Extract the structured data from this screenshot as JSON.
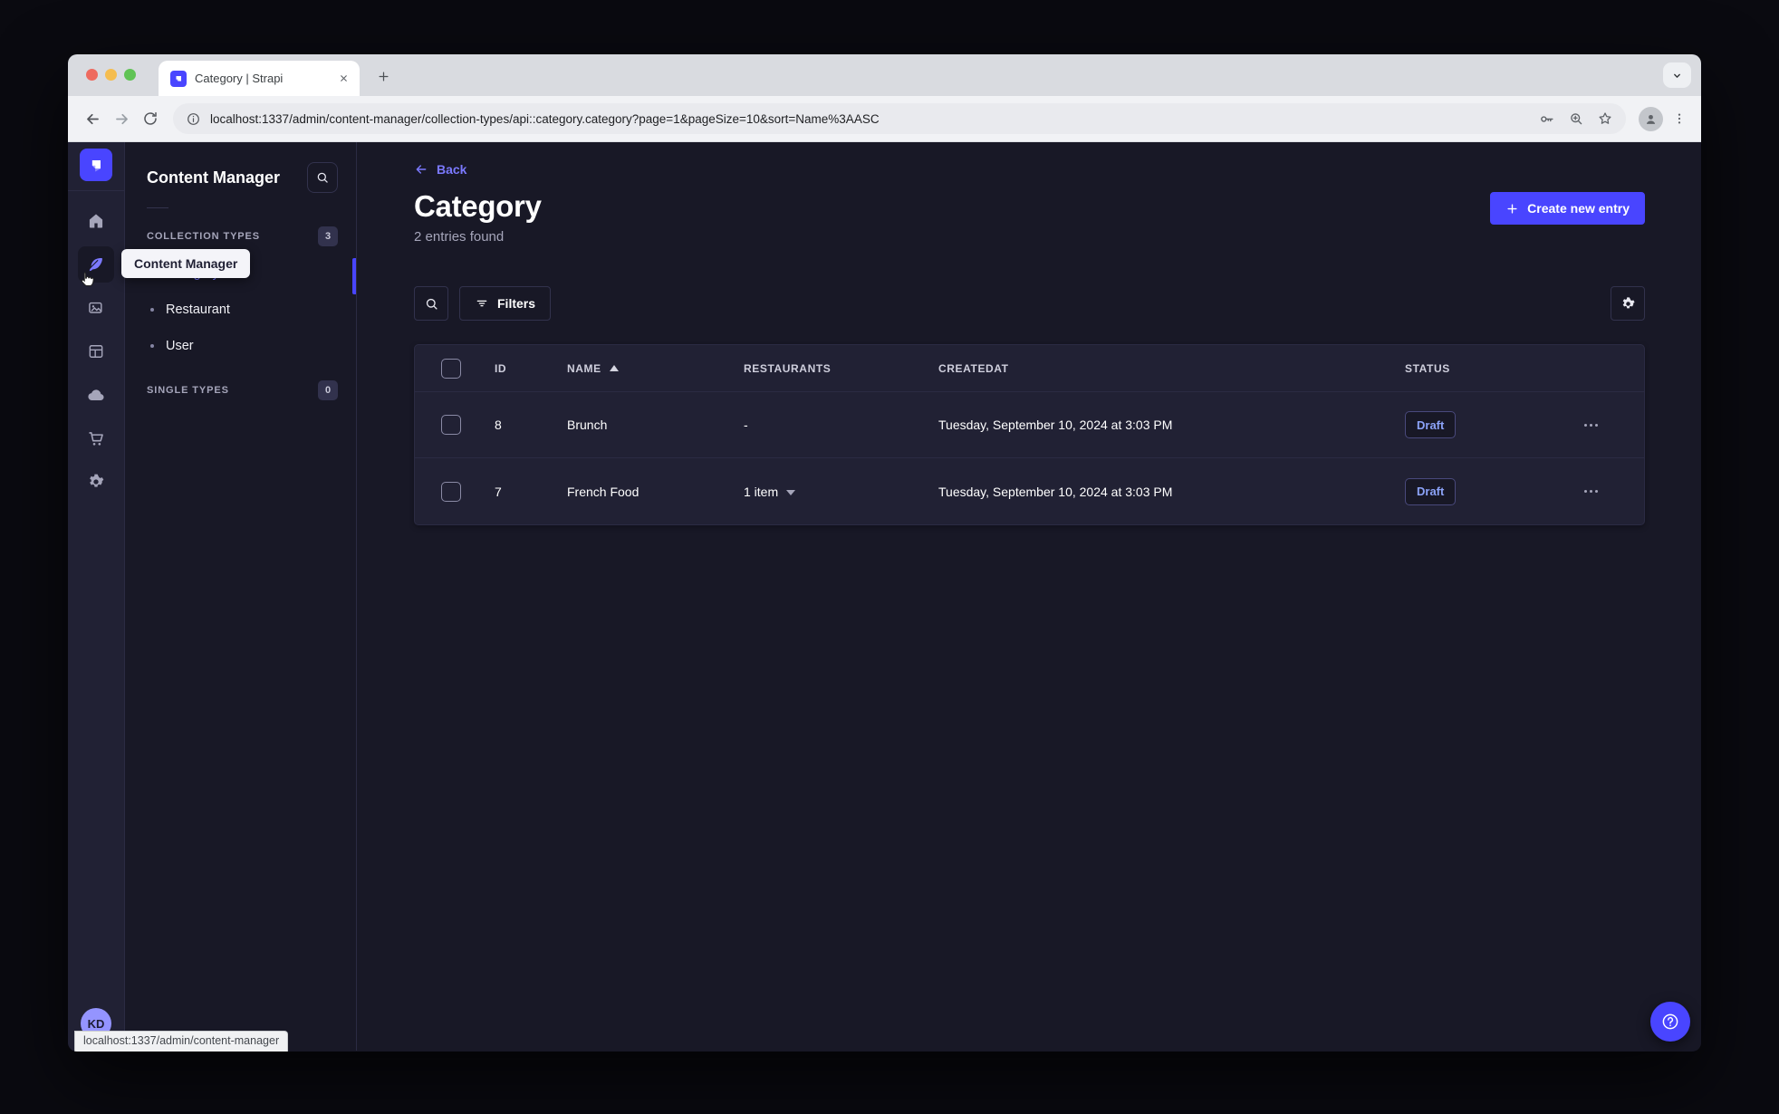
{
  "browser": {
    "tab_title": "Category | Strapi",
    "url": "localhost:1337/admin/content-manager/collection-types/api::category.category?page=1&pageSize=10&sort=Name%3AASC",
    "status_bar": "localhost:1337/admin/content-manager"
  },
  "colors": {
    "primary": "#4945ff",
    "primary_light": "#7b79ff",
    "page_bg": "#181826",
    "surface_bg": "#212134",
    "border": "#2b2b43",
    "draft_text": "#8ca3f8"
  },
  "icons": [
    "strapi-logo-icon",
    "home-icon",
    "content-manager-icon",
    "media-library-icon",
    "content-type-builder-icon",
    "cloud-icon",
    "marketplace-icon",
    "settings-icon",
    "search-icon",
    "filter-icon",
    "gear-icon",
    "plus-icon",
    "back-arrow-icon",
    "sort-asc-icon",
    "chevron-down-icon",
    "more-dots-icon",
    "help-icon",
    "cursor-pointer-icon"
  ],
  "rail": {
    "avatar_initials": "KD"
  },
  "sidebar": {
    "title": "Content Manager",
    "tooltip": "Content Manager",
    "sections": [
      {
        "label": "COLLECTION TYPES",
        "count": "3",
        "items": [
          {
            "label": "Category",
            "active": true
          },
          {
            "label": "Restaurant",
            "active": false
          },
          {
            "label": "User",
            "active": false
          }
        ]
      },
      {
        "label": "SINGLE TYPES",
        "count": "0",
        "items": []
      }
    ]
  },
  "main": {
    "back_label": "Back",
    "title": "Category",
    "subtitle": "2 entries found",
    "create_button": "Create new entry",
    "filters_button": "Filters"
  },
  "table": {
    "headers": [
      "ID",
      "NAME",
      "RESTAURANTS",
      "CREATEDAT",
      "STATUS"
    ],
    "rows": [
      {
        "id": "8",
        "name": "Brunch",
        "restaurants": "-",
        "restaurants_expandable": false,
        "createdAt": "Tuesday, September 10, 2024 at 3:03 PM",
        "status": "Draft"
      },
      {
        "id": "7",
        "name": "French Food",
        "restaurants": "1 item",
        "restaurants_expandable": true,
        "createdAt": "Tuesday, September 10, 2024 at 3:03 PM",
        "status": "Draft"
      }
    ]
  }
}
